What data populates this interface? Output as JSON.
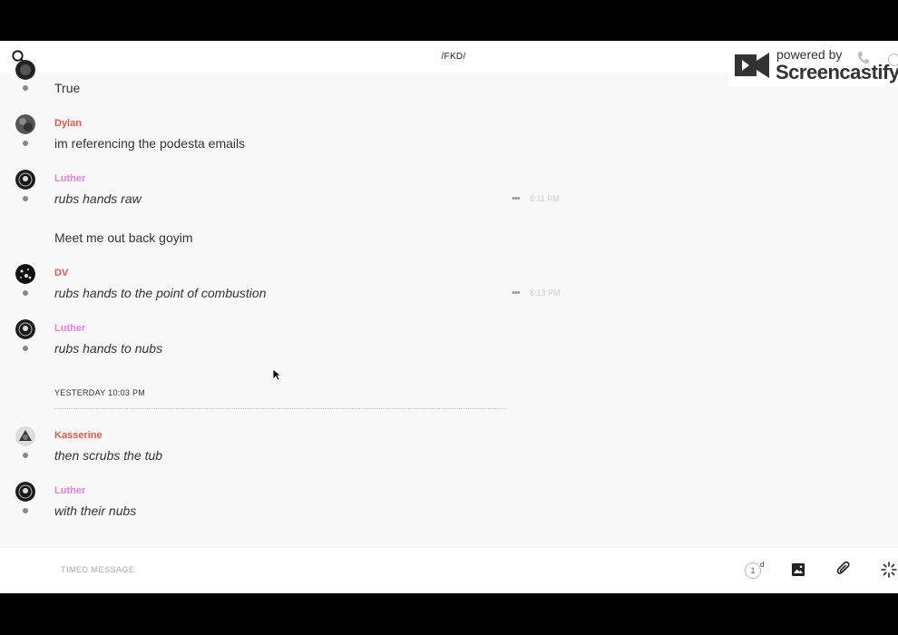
{
  "header": {
    "channel_title": "/FKD/"
  },
  "watermark": {
    "powered": "powered by",
    "brand": "Screencastify"
  },
  "messages": [
    {
      "author": "",
      "text": "True",
      "italic": false,
      "time": ""
    },
    {
      "author": "Dylan",
      "author_color": "#e05a4e",
      "text": "im referencing the podesta emails",
      "italic": false,
      "time": ""
    },
    {
      "author": "Luther",
      "author_color": "#e680d8",
      "text": "rubs hands raw",
      "italic": true,
      "time": "8:11 PM",
      "more": "•••"
    },
    {
      "author": "",
      "text": "Meet me out back goyim",
      "italic": false,
      "time": ""
    },
    {
      "author": "DV",
      "author_color": "#e05a4e",
      "text": "rubs hands to the point of combustion",
      "italic": true,
      "time": "8:13 PM",
      "more": "•••"
    },
    {
      "author": "Luther",
      "author_color": "#e680d8",
      "text": "rubs hands to nubs",
      "italic": true,
      "time": ""
    },
    {
      "author": "Kasserine",
      "author_color": "#e05a4e",
      "text": "then scrubs the tub",
      "italic": true,
      "time": ""
    },
    {
      "author": "Luther",
      "author_color": "#e680d8",
      "text": "with their nubs",
      "italic": true,
      "time": ""
    }
  ],
  "divider": {
    "label": "YESTERDAY 10:03 PM"
  },
  "composer": {
    "placeholder": "TIMED MESSAGE",
    "timer_value": "1",
    "timer_unit": "d",
    "icons": [
      "image-icon",
      "paperclip-icon",
      "sparkle-icon"
    ]
  }
}
